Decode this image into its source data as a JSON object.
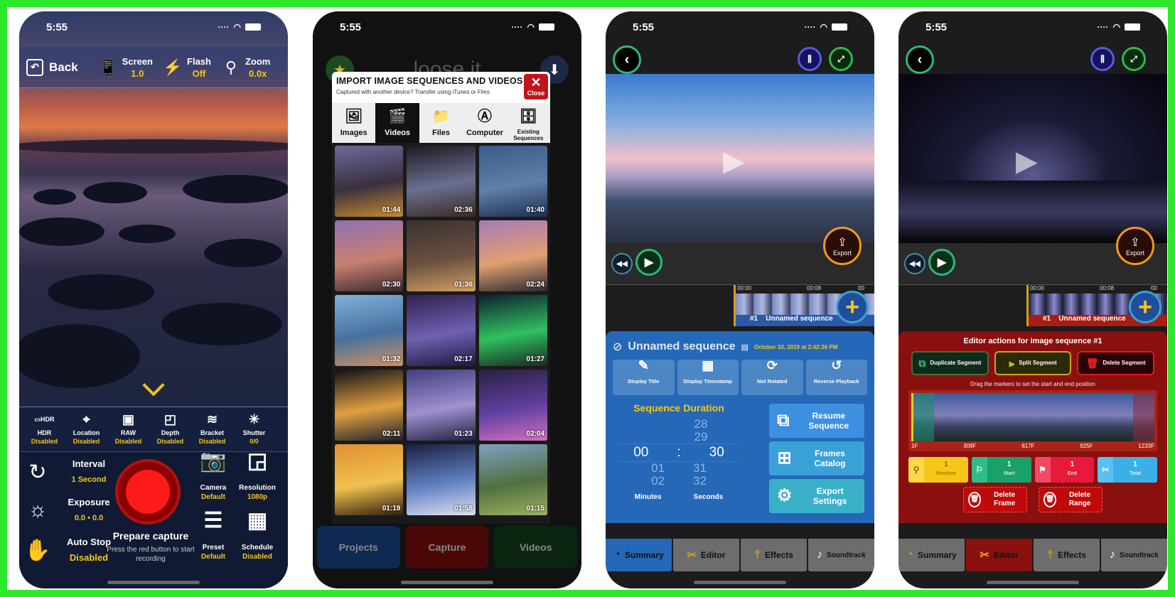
{
  "status_bar": {
    "time": "5:55"
  },
  "panel1": {
    "back_label": "Back",
    "toolbar": [
      {
        "icon": "screen-brightness-icon",
        "label": "Screen",
        "value": "1.0"
      },
      {
        "icon": "flash-icon",
        "label": "Flash",
        "value": "Off"
      },
      {
        "icon": "zoom-icon",
        "label": "Zoom",
        "value": "0.0x"
      }
    ],
    "options": [
      {
        "icon": "hdr-icon",
        "label": "HDR",
        "value": "Disabled"
      },
      {
        "icon": "location-icon",
        "label": "Location",
        "value": "Disabled"
      },
      {
        "icon": "raw-icon",
        "label": "RAW",
        "value": "Disabled"
      },
      {
        "icon": "depth-icon",
        "label": "Depth",
        "value": "Disabled"
      },
      {
        "icon": "bracket-icon",
        "label": "Bracket",
        "value": "Disabled"
      },
      {
        "icon": "shutter-icon",
        "label": "Shutter",
        "value": "0/0"
      }
    ],
    "controls": [
      {
        "icon": "interval-icon",
        "label": "Interval",
        "value": "1 Second"
      },
      {
        "icon": "exposure-icon",
        "label": "Exposure",
        "value": "0.0 • 0.0"
      },
      {
        "icon": "auto-stop-icon",
        "label": "Auto Stop",
        "value": "Disabled"
      }
    ],
    "capture": {
      "title": "Prepare capture",
      "subtitle": "Press the red button to start recording"
    },
    "right_buttons": [
      {
        "icon": "camera-icon",
        "label": "Camera",
        "value": "Default"
      },
      {
        "icon": "resolution-icon",
        "label": "Resolution",
        "value": "1080p"
      },
      {
        "icon": "preset-icon",
        "label": "Preset",
        "value": "Default"
      },
      {
        "icon": "schedule-icon",
        "label": "Schedule",
        "value": "Disabled"
      }
    ]
  },
  "panel2": {
    "logo_text": "loose it",
    "modal": {
      "title": "IMPORT IMAGE SEQUENCES AND VIDEOS",
      "subtitle": "Captured with another device? Transfer using iTunes or Files",
      "close_label": "Close",
      "tabs": [
        {
          "icon": "images-icon",
          "label": "Images"
        },
        {
          "icon": "videos-icon",
          "label": "Videos",
          "active": true
        },
        {
          "icon": "files-icon",
          "label": "Files"
        },
        {
          "icon": "computer-icon",
          "label": "Computer"
        },
        {
          "icon": "existing-sequences-icon",
          "label": "Existing Sequences"
        }
      ],
      "videos": [
        {
          "duration": "01:44",
          "colors": [
            "#6d6a9a",
            "#3a3040",
            "#c58a30"
          ]
        },
        {
          "duration": "02:36",
          "colors": [
            "#1e1a22",
            "#6a6f90",
            "#3a2a20"
          ]
        },
        {
          "duration": "01:40",
          "colors": [
            "#3a5a8a",
            "#6080a8",
            "#1d3050"
          ]
        },
        {
          "duration": "02:30",
          "colors": [
            "#9070b0",
            "#c88070",
            "#3a2a30"
          ]
        },
        {
          "duration": "01:36",
          "colors": [
            "#3a3030",
            "#6a5040",
            "#d0a060"
          ]
        },
        {
          "duration": "02:24",
          "colors": [
            "#a87ab8",
            "#e0a070",
            "#2a2a30"
          ]
        },
        {
          "duration": "01:32",
          "colors": [
            "#80b0d8",
            "#4870a0",
            "#d09060"
          ]
        },
        {
          "duration": "02:17",
          "colors": [
            "#302050",
            "#7060b0",
            "#1a1a40"
          ]
        },
        {
          "duration": "01:27",
          "colors": [
            "#0d2030",
            "#30c060",
            "#1a2a20"
          ]
        },
        {
          "duration": "02:11",
          "colors": [
            "#101018",
            "#e0a040",
            "#202030"
          ]
        },
        {
          "duration": "01:23",
          "colors": [
            "#404080",
            "#a090d0",
            "#202040"
          ]
        },
        {
          "duration": "02:04",
          "colors": [
            "#2a2040",
            "#6040a0",
            "#d070c0"
          ]
        },
        {
          "duration": "01:19",
          "colors": [
            "#e09030",
            "#f0c050",
            "#302010"
          ]
        },
        {
          "duration": "01:58",
          "colors": [
            "#1a2040",
            "#6080c0",
            "#e0e0f0"
          ]
        },
        {
          "duration": "01:15",
          "colors": [
            "#80a0c0",
            "#507040",
            "#a0b060"
          ]
        }
      ]
    },
    "nav": [
      {
        "icon": "projects-icon",
        "label": "Projects"
      },
      {
        "icon": "capture-icon",
        "label": "Capture"
      },
      {
        "icon": "videos-icon",
        "label": "Videos"
      }
    ]
  },
  "panel3": {
    "export_label": "Export",
    "timeline": {
      "marks": [
        "00:00",
        "00:08",
        "00"
      ],
      "clip_number": "#1",
      "clip_name": "Unnamed sequence"
    },
    "summary": {
      "name": "Unnamed sequence",
      "date": "October 10, 2019 at 2:42:36 PM",
      "buttons": [
        {
          "icon": "display-title-icon",
          "label": "Display Title"
        },
        {
          "icon": "display-timestamp-icon",
          "label": "Display Timestamp"
        },
        {
          "icon": "rotate-icon",
          "label": "Not Rotated"
        },
        {
          "icon": "reverse-playback-icon",
          "label": "Reverse Playback"
        }
      ],
      "duration_label": "Sequence Duration",
      "minutes": {
        "above": [
          "",
          ""
        ],
        "selected": "00",
        "below": [
          "01",
          "02"
        ]
      },
      "seconds": {
        "above": [
          "28",
          "29"
        ],
        "selected": "30",
        "below": [
          "31",
          "32"
        ]
      },
      "minutes_label": "Minutes",
      "seconds_label": "Seconds",
      "actions": [
        {
          "icon": "resume-sequence-icon",
          "label": "Resume Sequence",
          "color": "#3d8fe0"
        },
        {
          "icon": "frames-catalog-icon",
          "label": "Frames Catalog",
          "color": "#3aa0d8"
        },
        {
          "icon": "export-settings-icon",
          "label": "Export Settings",
          "color": "#3ab0c8"
        }
      ]
    },
    "tabs": [
      {
        "icon": "summary-icon",
        "label": "Summary",
        "active": true
      },
      {
        "icon": "editor-icon",
        "label": "Editor"
      },
      {
        "icon": "effects-icon",
        "label": "Effects"
      },
      {
        "icon": "soundtrack-icon",
        "label": "Soundtrack"
      }
    ]
  },
  "panel4": {
    "export_label": "Export",
    "timeline": {
      "marks": [
        "00:00",
        "00:08",
        "00"
      ],
      "clip_number": "#1",
      "clip_name": "Unnamed sequence"
    },
    "editor": {
      "title": "Editor actions for image sequence #1",
      "buttons": [
        {
          "icon": "duplicate-segment-icon",
          "label": "Duplicate Segment"
        },
        {
          "icon": "split-segment-icon",
          "label": "Split Segment"
        },
        {
          "icon": "delete-segment-icon",
          "label": "Delete Segment"
        }
      ],
      "hint": "Drag the markers to set the start and end position",
      "frame_marks": [
        "1F",
        "309F",
        "617F",
        "925F",
        "1233F"
      ],
      "counters": [
        {
          "icon": "pin-icon",
          "value": "1",
          "label": "Position",
          "color": "#f5c518",
          "dark": "#e8a800"
        },
        {
          "icon": "flag-start-icon",
          "value": "1",
          "label": "Start",
          "color": "#1aa06a",
          "dark": "#2fbc88"
        },
        {
          "icon": "flag-end-icon",
          "value": "1",
          "label": "End",
          "color": "#e81a3a",
          "dark": "#f04a60"
        },
        {
          "icon": "scissors-icon",
          "value": "1",
          "label": "Total",
          "color": "#3ab0e8",
          "dark": "#5ac0f0"
        }
      ],
      "delete_buttons": [
        {
          "icon": "trash-icon",
          "label": "Delete Frame"
        },
        {
          "icon": "trash-icon",
          "label": "Delete Range"
        }
      ]
    },
    "tabs": [
      {
        "icon": "summary-icon",
        "label": "Summary"
      },
      {
        "icon": "editor-icon",
        "label": "Editor",
        "active": true
      },
      {
        "icon": "effects-icon",
        "label": "Effects"
      },
      {
        "icon": "soundtrack-icon",
        "label": "Soundtrack"
      }
    ]
  }
}
